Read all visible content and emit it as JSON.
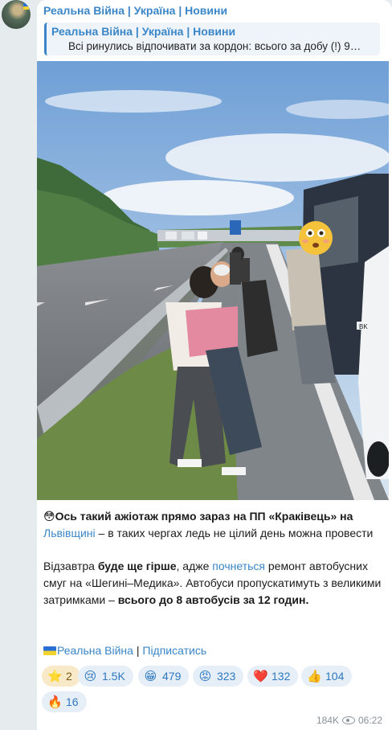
{
  "channel": {
    "name": "Реальна Війна | Україна | Новини"
  },
  "reply": {
    "title": "Реальна Війна | Україна | Новини",
    "text": "Всі ринулись відпочивати за кордон: всього за добу (!) 9…"
  },
  "photo": {
    "overlay_emoji": "😳",
    "plate_text": "BK"
  },
  "post": {
    "lead_emoji": "😳",
    "p1_bold": "Ось такий ажіотаж прямо зараз на ПП «Краківець» на",
    "p1_link": "Львівщині",
    "p1_rest": " – в таких чергах ледь не цілий день можна провести",
    "p2_a": "Відзавтра ",
    "p2_bold1": "буде ще гірше",
    "p2_b": ", адже ",
    "p2_link": "почнеться",
    "p2_c": " ремонт автобусних смуг на «Шегині–Медика». Автобуси пропускатимуть з великими затримками – ",
    "p2_bold2": "всього до 8 автобусів за 12 годин."
  },
  "footer": {
    "channel_link": "Реальна Війна",
    "separator": " | ",
    "subscribe_link": "Підписатись"
  },
  "reactions": [
    {
      "emoji": "⭐",
      "count": "2",
      "icon": "star-icon"
    },
    {
      "emoji": "😢",
      "count": "1.5K",
      "icon": "crying-face-icon"
    },
    {
      "emoji": "😁",
      "count": "479",
      "icon": "grinning-face-icon"
    },
    {
      "emoji": "😡",
      "count": "323",
      "icon": "angry-face-icon"
    },
    {
      "emoji": "❤️",
      "count": "132",
      "icon": "heart-icon"
    },
    {
      "emoji": "👍",
      "count": "104",
      "icon": "thumbs-up-icon"
    },
    {
      "emoji": "🔥",
      "count": "16",
      "icon": "fire-icon"
    }
  ],
  "meta": {
    "views": "184K",
    "time": "06:22"
  }
}
